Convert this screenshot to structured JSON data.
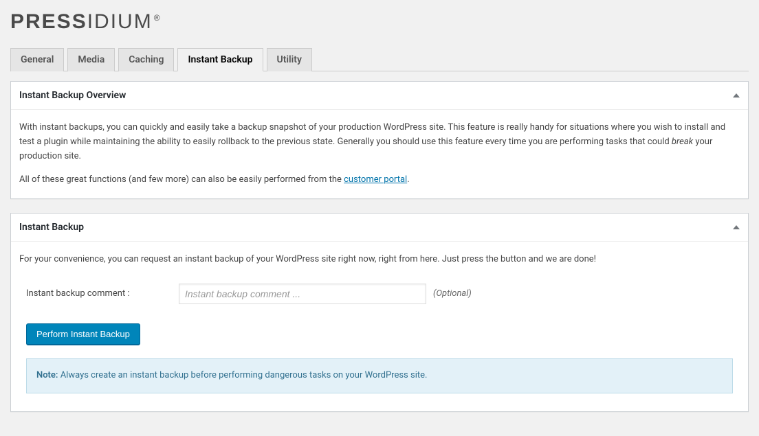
{
  "brand": {
    "prefix": "PRESS",
    "suffix": "IDIUM",
    "registered": "®"
  },
  "tabs": {
    "general": "General",
    "media": "Media",
    "caching": "Caching",
    "instant_backup": "Instant Backup",
    "utility": "Utility"
  },
  "overview_panel": {
    "title": "Instant Backup Overview",
    "p1_part1": "With instant backups, you can quickly and easily take a backup snapshot of your production WordPress site. This feature is really handy for situations where you wish to install and test a plugin while maintaining the ability to easily rollback to the previous state. Generally you should use this feature every time you are performing tasks that could ",
    "p1_break": "break",
    "p1_part2": " your production site.",
    "p2_part1": "All of these great functions (and few more) can also be easily performed from the ",
    "p2_link": "customer portal",
    "p2_part2": "."
  },
  "backup_panel": {
    "title": "Instant Backup",
    "intro": "For your convenience, you can request an instant backup of your WordPress site right now, right from here. Just press the button and we are done!",
    "comment_label": "Instant backup comment :",
    "comment_placeholder": "Instant backup comment ...",
    "optional": "(Optional)",
    "button": "Perform Instant Backup",
    "note_label": "Note:",
    "note_text": " Always create an instant backup before performing dangerous tasks on your WordPress site."
  }
}
